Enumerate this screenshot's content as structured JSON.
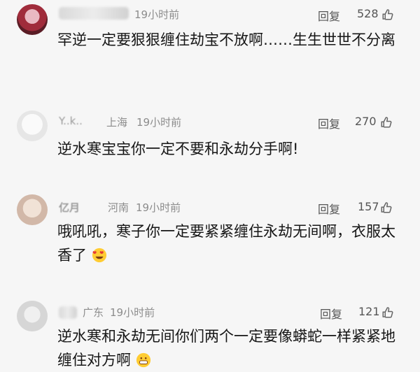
{
  "comments": [
    {
      "time": "19小时前",
      "reply": "回复",
      "likes": "528",
      "text": "罕逆一定要狠狠缠住劫宝不放啊……生生世世不分离"
    },
    {
      "username": "Y..k..",
      "location": "上海",
      "time": "19小时前",
      "reply": "回复",
      "likes": "270",
      "text": "逆水寒宝宝你一定不要和永劫分手啊!"
    },
    {
      "username": "亿月",
      "location": "河南",
      "time": "19小时前",
      "reply": "回复",
      "likes": "157",
      "text": "哦吼吼，寒子你一定要紧紧缠住永劫无间啊，衣服太香了",
      "emoji": "heart-eyes-emoji"
    },
    {
      "location": "广东",
      "time": "19小时前",
      "reply": "回复",
      "likes": "121",
      "text": "逆水寒和永劫无间你们两个一定要像蟒蛇一样紧紧地缠住对方啊",
      "emoji": "grimace-emoji"
    }
  ]
}
